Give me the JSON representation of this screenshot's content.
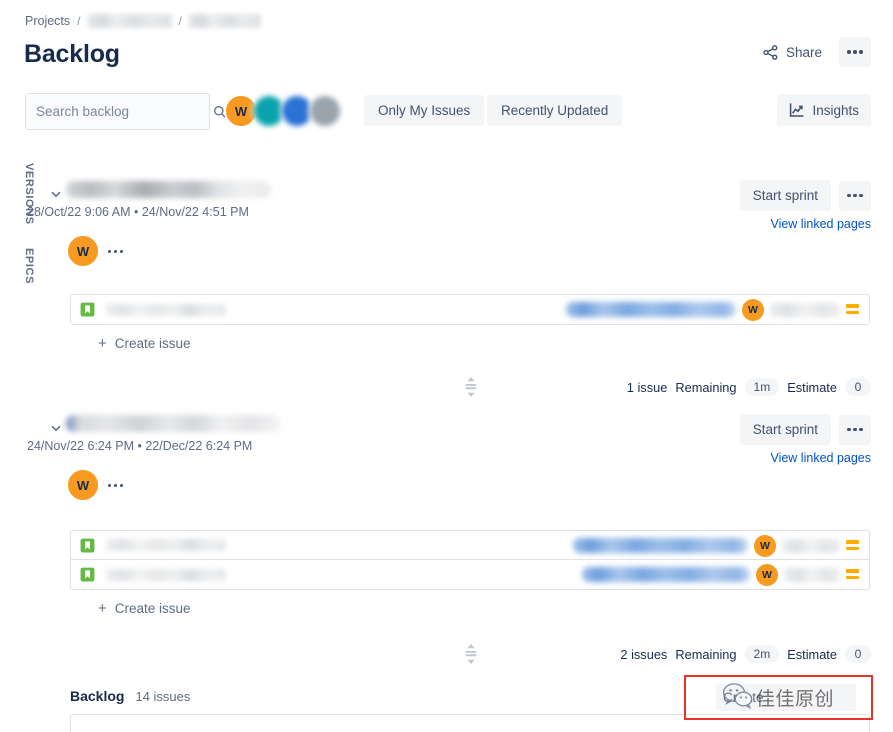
{
  "breadcrumb": {
    "root_label": "Projects",
    "separator": "/",
    "redacted_items": 2
  },
  "header": {
    "title": "Backlog",
    "share_label": "Share",
    "more_icon": "more-horizontal-icon",
    "share_icon": "share-icon",
    "insights_label": "Insights",
    "insights_icon": "insights-chart-icon"
  },
  "toolbar": {
    "search": {
      "placeholder": "Search backlog",
      "value": "",
      "icon": "search-icon"
    },
    "avatars": [
      {
        "initials": "W",
        "color": "#f79a1f",
        "blurred": false
      },
      {
        "initials": "",
        "color": "#0aa3ad",
        "blurred": true
      },
      {
        "initials": "",
        "color": "#2a72d4",
        "blurred": true
      },
      {
        "initials": "",
        "color": "#9aa4ad",
        "blurred": true
      }
    ],
    "filters": [
      {
        "label": "Only My Issues"
      },
      {
        "label": "Recently Updated"
      }
    ]
  },
  "side_labels": {
    "versions": "VERSIONS",
    "epics": "EPICS"
  },
  "sprints": [
    {
      "name_redacted": true,
      "chevron_icon": "chevron-down-icon",
      "dates": "28/Oct/22 9:06 AM  •  24/Nov/22 4:51 PM",
      "start_sprint_label": "Start sprint",
      "more_icon": "more-horizontal-icon",
      "linked_pages_label": "View linked pages",
      "epic_avatar": {
        "initials": "W",
        "color": "#f79a1f"
      },
      "epic_more_icon": "more-horizontal-icon",
      "issues": [
        {
          "type_icon": "story-icon",
          "type_color": "#65ba43",
          "key_redacted": true,
          "summary_redacted": true,
          "summary_width": 170,
          "badge_width": 70,
          "badge_text": "9",
          "avatar": {
            "initials": "W",
            "color": "#f79a1f"
          },
          "priority_icon": "priority-medium-icon",
          "priority_color": "#ffab00"
        }
      ],
      "create_issue_label": "Create issue",
      "create_issue_icon": "plus-icon",
      "footer": {
        "resize_icon": "resize-vertical-icon",
        "issue_count": "1 issue",
        "remaining_label": "Remaining",
        "remaining_value": "1m",
        "estimate_label": "Estimate",
        "estimate_value": "0"
      }
    },
    {
      "name_redacted": true,
      "chevron_icon": "chevron-down-icon",
      "dates": "24/Nov/22 6:24 PM  •  22/Dec/22 6:24 PM",
      "start_sprint_label": "Start sprint",
      "more_icon": "more-horizontal-icon",
      "linked_pages_label": "View linked pages",
      "epic_avatar": {
        "initials": "W",
        "color": "#f79a1f"
      },
      "epic_more_icon": "more-horizontal-icon",
      "issues": [
        {
          "type_icon": "story-icon",
          "type_color": "#65ba43",
          "key_redacted": true,
          "summary_redacted": true,
          "summary_width": 175,
          "badge_width": 58,
          "badge_text": "",
          "avatar": {
            "initials": "W",
            "color": "#f79a1f"
          },
          "priority_icon": "priority-medium-icon",
          "priority_color": "#ffab00"
        },
        {
          "type_icon": "story-icon",
          "type_color": "#65ba43",
          "key_redacted": true,
          "summary_redacted": true,
          "summary_width": 168,
          "badge_width": 56,
          "badge_text": "",
          "avatar": {
            "initials": "W",
            "color": "#f79a1f"
          },
          "priority_icon": "priority-medium-icon",
          "priority_color": "#ffab00"
        }
      ],
      "create_issue_label": "Create issue",
      "create_issue_icon": "plus-icon",
      "footer": {
        "resize_icon": "resize-vertical-icon",
        "issue_count": "2 issues",
        "remaining_label": "Remaining",
        "remaining_value": "2m",
        "estimate_label": "Estimate",
        "estimate_value": "0"
      }
    }
  ],
  "backlog_section": {
    "title": "Backlog",
    "count_label": "14 issues",
    "create_button_label": "Create"
  },
  "watermark": {
    "text": "佳佳原创",
    "logo_icon": "wechat-logo-icon",
    "border_color": "#e8342a"
  },
  "colors": {
    "accent_blue": "#0052cc",
    "text_primary": "#172b4d",
    "text_subtle": "#5e6c84",
    "surface_subtle": "#f4f5f7",
    "border": "#dfe1e6",
    "avatar_orange": "#f79a1f",
    "story_green": "#65ba43",
    "priority_orange": "#ffab00"
  }
}
